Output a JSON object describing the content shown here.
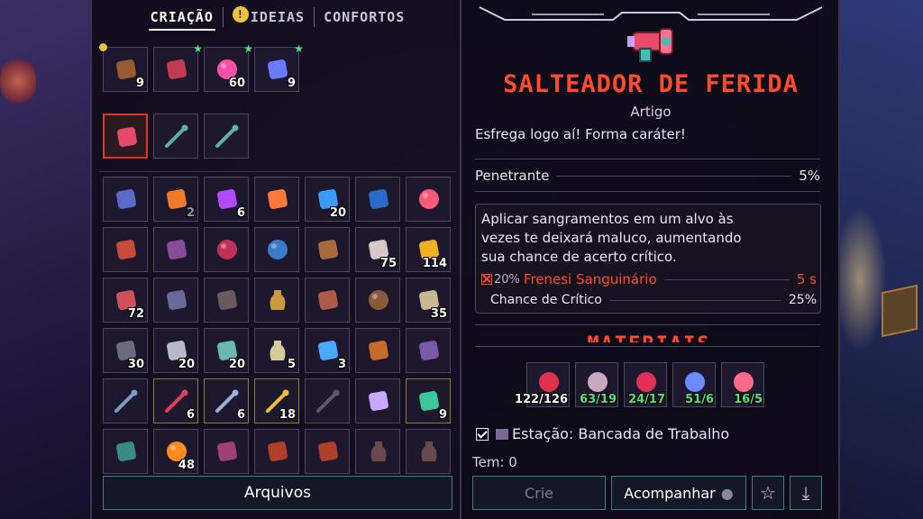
{
  "tabs": [
    {
      "label": "CRIAÇÃO",
      "active": true
    },
    {
      "label": "IDEIAS",
      "badge": "!"
    },
    {
      "label": "CONFORTOS"
    }
  ],
  "inventory": {
    "row1": [
      {
        "icon": "leather-icon",
        "count": "9",
        "bulb": true
      },
      {
        "icon": "rose-icon",
        "count": "",
        "star": true
      },
      {
        "icon": "pink-coral-icon",
        "count": "60",
        "star": true
      },
      {
        "icon": "blue-bundle-icon",
        "count": "9",
        "star": true
      }
    ],
    "row2": [
      {
        "icon": "blaster-icon",
        "count": "",
        "selected": true
      },
      {
        "icon": "sword-icon",
        "count": ""
      },
      {
        "icon": "sword-icon",
        "count": ""
      }
    ],
    "grid": [
      [
        "blue-creature-icon",
        "",
        "fang-icon",
        "2",
        "purple-gem-box-icon",
        "6",
        "flame-icon",
        "",
        "washer-icon",
        "20",
        "blue-panel-icon",
        "",
        "pink-blob-icon",
        ""
      ],
      [
        "gift-chest-icon",
        "",
        "tentacle-icon",
        "",
        "red-berry-icon",
        "",
        "blue-berry-icon",
        "",
        "gift-box-icon",
        "",
        "bandage-icon",
        "75",
        "gold-crystal-icon",
        "114"
      ],
      [
        "ribbon-roll-icon",
        "72",
        "ash-pile-icon",
        "",
        "log-icon",
        "",
        "shield-potion-icon",
        "",
        "meat-bone-icon",
        "",
        "dirt-ball-icon",
        "",
        "stone-block-icon",
        "35"
      ],
      [
        "rope-coil-icon",
        "30",
        "rock-icon",
        "20",
        "teal-figure-icon",
        "20",
        "jug-icon",
        "5",
        "crystal-bar-icon",
        "3",
        "root-icon",
        "",
        "spiky-worm-icon",
        ""
      ],
      [
        "spear-icon",
        "",
        "mace-icon",
        "6",
        "scepter-icon",
        "6",
        "yellow-spear-icon",
        "18",
        "staff-icon",
        "",
        "snowflake-icon",
        "",
        "drone-icon",
        "9"
      ],
      [
        "crossed-bones-icon",
        "",
        "fire-orb-icon",
        "48",
        "bundle-icon",
        "",
        "chest-icon",
        "",
        "chest-icon",
        "",
        "urn-icon",
        "",
        "urn-icon",
        ""
      ]
    ]
  },
  "archive_label": "Arquivos",
  "item": {
    "name": "SALTEADOR DE FERIDA",
    "type": "Artigo",
    "flavor": "Esfrega logo aí! Forma caráter!",
    "stat_label": "Penetrante",
    "stat_value": "5%",
    "description": "Aplicar sangramentos em um alvo às vezes te deixará maluco, aumentando sua chance de acerto crítico.",
    "effect_chance": "20%",
    "effect_name": "Frenesi Sanguinário",
    "effect_duration": "5 s",
    "crit_label": "Chance de Crítico",
    "crit_value": "25%",
    "materials_header": "MATERIAIS",
    "materials": [
      {
        "icon": "red-claw-icon",
        "qty": "122/126",
        "color": "#ffffff"
      },
      {
        "icon": "fossil-icon",
        "qty": "63/19",
        "color": "#58e07a"
      },
      {
        "icon": "red-spider-icon",
        "qty": "24/17",
        "color": "#58e07a"
      },
      {
        "icon": "blue-crystal-icon",
        "qty": "51/6",
        "color": "#58e07a"
      },
      {
        "icon": "flower-icon",
        "qty": "16/5",
        "color": "#58e07a"
      }
    ],
    "station": "Estação: Bancada de Trabalho",
    "have": "Tem: 0"
  },
  "buttons": {
    "craft": "Crie",
    "track": "Acompanhar"
  },
  "colors": {
    "accent_red": "#ff4b2a",
    "green_qty": "#58e07a",
    "teal_border": "#3f7f86"
  }
}
